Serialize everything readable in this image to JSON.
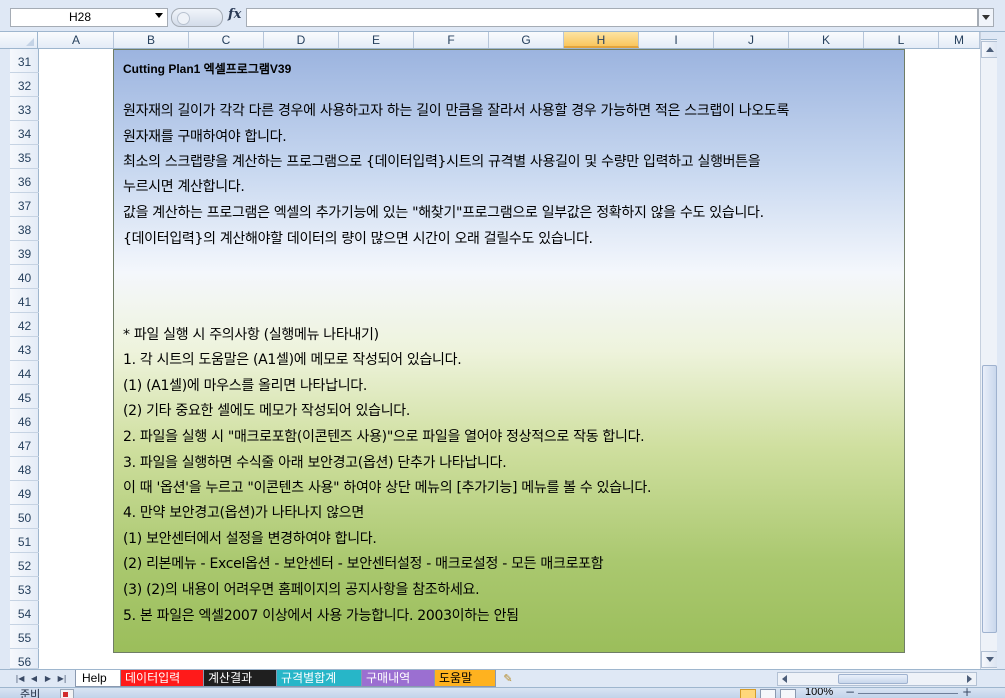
{
  "formula_bar": {
    "name_box": "H28",
    "fx_label": "fx",
    "formula": ""
  },
  "columns": [
    "A",
    "B",
    "C",
    "D",
    "E",
    "F",
    "G",
    "H",
    "I",
    "J",
    "K",
    "L",
    "M"
  ],
  "active_column": "H",
  "rows": [
    "31",
    "32",
    "33",
    "34",
    "35",
    "36",
    "37",
    "38",
    "39",
    "40",
    "41",
    "42",
    "43",
    "44",
    "45",
    "46",
    "47",
    "48",
    "49",
    "50",
    "51",
    "52",
    "53",
    "54",
    "55",
    "56"
  ],
  "help": {
    "title": "Cutting Plan1 엑셀프로그램V39",
    "lines": [
      "원자재의 길이가 각각 다른 경우에 사용하고자 하는 길이 만큼을 잘라서 사용할 경우 가능하면 적은 스크랩이 나오도록",
      "원자재를 구매하여야 합니다.",
      "최소의 스크랩량을 계산하는 프로그램으로 {데이터입력}시트의 규격별 사용길이 및 수량만 입력하고 실행버튼을",
      "누르시면 계산합니다.",
      "값을 계산하는 프로그램은 엑셀의 추가기능에 있는 \"해찾기\"프로그램으로 일부값은 정확하지 않을 수도 있습니다.",
      "{데이터입력}의 계산해야할 데이터의 량이 많으면 시간이 오래 걸릴수도 있습니다.",
      "* 파일 실행 시 주의사항 (실행메뉴 나타내기)",
      "1. 각 시트의 도움말은 (A1셀)에 메모로 작성되어 있습니다.",
      "  (1) (A1셀)에 마우스를 올리면 나타납니다.",
      "  (2) 기타 중요한 셀에도 메모가 작성되어 있습니다.",
      "2. 파일을 실행 시 \"매크로포함(이콘텐즈 사용)\"으로 파일을 열어야 정상적으로 작동 합니다.",
      "3. 파일을 실행하면 수식줄 아래 보안경고(옵션) 단추가 나타납니다.",
      "   이 때 '옵션'을 누르고 \"이콘텐츠 사용\" 하여야 상단 메뉴의 [추가기능] 메뉴를 볼 수 있습니다.",
      "4. 만약 보안경고(옵션)가 나타나지 않으면",
      "  (1) 보안센터에서 설정을 변경하여야 합니다.",
      "  (2) 리본메뉴 - Excel옵션 - 보안센터 - 보안센터설정 - 매크로설정 - 모든 매크로포함",
      "  (3) (2)의 내용이 어려우면 홈페이지의 공지사항을 참조하세요.",
      "5. 본 파일은 엑셀2007 이상에서 사용 가능합니다. 2003이하는 안됨"
    ]
  },
  "sheet_tabs": [
    "Help",
    "데이터입력",
    "계산결과",
    "규격별합계",
    "구매내역",
    "도움말"
  ],
  "tab_colors": [
    "#ffffff",
    "#ff1a1a",
    "#1f1f1f",
    "#27b6c8",
    "#9b6fd1",
    "#ffb21f"
  ],
  "status": {
    "mode": "준비",
    "zoom": "100%",
    "zoom_minus": "−",
    "zoom_plus": "+"
  },
  "icons": [
    "dropdown-arrow-icon",
    "scroll-up-icon",
    "scroll-down-icon",
    "scroll-left-icon",
    "scroll-right-icon",
    "insert-sheet-icon",
    "macro-record-icon"
  ]
}
